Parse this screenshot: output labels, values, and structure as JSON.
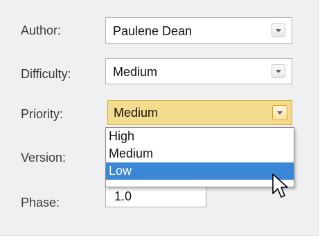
{
  "form": {
    "author_label": "Author:",
    "author_value": "Paulene Dean",
    "difficulty_label": "Difficulty:",
    "difficulty_value": "Medium",
    "priority_label": "Priority:",
    "priority_value": "Medium",
    "version_label": "Version:",
    "phase_label": "Phase:",
    "phase_value": "1.0"
  },
  "priority_dropdown": {
    "options": [
      "High",
      "Medium",
      "Low"
    ],
    "selected": "Low"
  },
  "colors": {
    "panel_bg": "#eef0f2",
    "active_combo_bg": "#f4dc8e",
    "active_combo_border": "#d8a93b",
    "selection_bg": "#3b86d6"
  },
  "icons": {
    "dropdown": "chevron-down-icon",
    "pointer": "mouse-cursor-icon"
  }
}
